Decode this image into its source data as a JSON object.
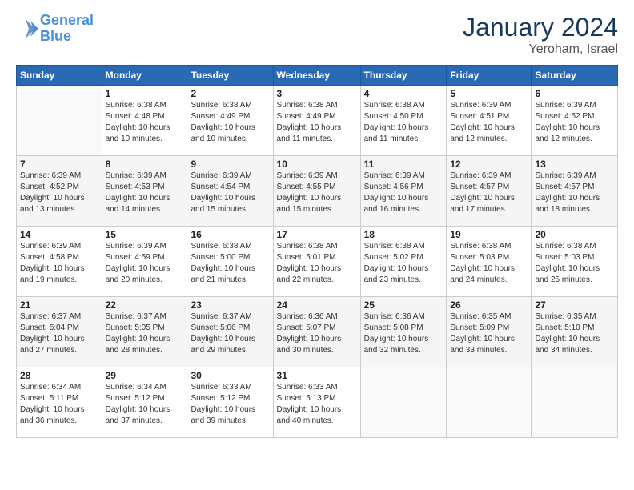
{
  "header": {
    "logo_line1": "General",
    "logo_line2": "Blue",
    "month": "January 2024",
    "location": "Yeroham, Israel"
  },
  "days_of_week": [
    "Sunday",
    "Monday",
    "Tuesday",
    "Wednesday",
    "Thursday",
    "Friday",
    "Saturday"
  ],
  "weeks": [
    [
      {
        "day": "",
        "info": ""
      },
      {
        "day": "1",
        "info": "Sunrise: 6:38 AM\nSunset: 4:48 PM\nDaylight: 10 hours\nand 10 minutes."
      },
      {
        "day": "2",
        "info": "Sunrise: 6:38 AM\nSunset: 4:49 PM\nDaylight: 10 hours\nand 10 minutes."
      },
      {
        "day": "3",
        "info": "Sunrise: 6:38 AM\nSunset: 4:49 PM\nDaylight: 10 hours\nand 11 minutes."
      },
      {
        "day": "4",
        "info": "Sunrise: 6:38 AM\nSunset: 4:50 PM\nDaylight: 10 hours\nand 11 minutes."
      },
      {
        "day": "5",
        "info": "Sunrise: 6:39 AM\nSunset: 4:51 PM\nDaylight: 10 hours\nand 12 minutes."
      },
      {
        "day": "6",
        "info": "Sunrise: 6:39 AM\nSunset: 4:52 PM\nDaylight: 10 hours\nand 12 minutes."
      }
    ],
    [
      {
        "day": "7",
        "info": "Sunrise: 6:39 AM\nSunset: 4:52 PM\nDaylight: 10 hours\nand 13 minutes."
      },
      {
        "day": "8",
        "info": "Sunrise: 6:39 AM\nSunset: 4:53 PM\nDaylight: 10 hours\nand 14 minutes."
      },
      {
        "day": "9",
        "info": "Sunrise: 6:39 AM\nSunset: 4:54 PM\nDaylight: 10 hours\nand 15 minutes."
      },
      {
        "day": "10",
        "info": "Sunrise: 6:39 AM\nSunset: 4:55 PM\nDaylight: 10 hours\nand 15 minutes."
      },
      {
        "day": "11",
        "info": "Sunrise: 6:39 AM\nSunset: 4:56 PM\nDaylight: 10 hours\nand 16 minutes."
      },
      {
        "day": "12",
        "info": "Sunrise: 6:39 AM\nSunset: 4:57 PM\nDaylight: 10 hours\nand 17 minutes."
      },
      {
        "day": "13",
        "info": "Sunrise: 6:39 AM\nSunset: 4:57 PM\nDaylight: 10 hours\nand 18 minutes."
      }
    ],
    [
      {
        "day": "14",
        "info": "Sunrise: 6:39 AM\nSunset: 4:58 PM\nDaylight: 10 hours\nand 19 minutes."
      },
      {
        "day": "15",
        "info": "Sunrise: 6:39 AM\nSunset: 4:59 PM\nDaylight: 10 hours\nand 20 minutes."
      },
      {
        "day": "16",
        "info": "Sunrise: 6:38 AM\nSunset: 5:00 PM\nDaylight: 10 hours\nand 21 minutes."
      },
      {
        "day": "17",
        "info": "Sunrise: 6:38 AM\nSunset: 5:01 PM\nDaylight: 10 hours\nand 22 minutes."
      },
      {
        "day": "18",
        "info": "Sunrise: 6:38 AM\nSunset: 5:02 PM\nDaylight: 10 hours\nand 23 minutes."
      },
      {
        "day": "19",
        "info": "Sunrise: 6:38 AM\nSunset: 5:03 PM\nDaylight: 10 hours\nand 24 minutes."
      },
      {
        "day": "20",
        "info": "Sunrise: 6:38 AM\nSunset: 5:03 PM\nDaylight: 10 hours\nand 25 minutes."
      }
    ],
    [
      {
        "day": "21",
        "info": "Sunrise: 6:37 AM\nSunset: 5:04 PM\nDaylight: 10 hours\nand 27 minutes."
      },
      {
        "day": "22",
        "info": "Sunrise: 6:37 AM\nSunset: 5:05 PM\nDaylight: 10 hours\nand 28 minutes."
      },
      {
        "day": "23",
        "info": "Sunrise: 6:37 AM\nSunset: 5:06 PM\nDaylight: 10 hours\nand 29 minutes."
      },
      {
        "day": "24",
        "info": "Sunrise: 6:36 AM\nSunset: 5:07 PM\nDaylight: 10 hours\nand 30 minutes."
      },
      {
        "day": "25",
        "info": "Sunrise: 6:36 AM\nSunset: 5:08 PM\nDaylight: 10 hours\nand 32 minutes."
      },
      {
        "day": "26",
        "info": "Sunrise: 6:35 AM\nSunset: 5:09 PM\nDaylight: 10 hours\nand 33 minutes."
      },
      {
        "day": "27",
        "info": "Sunrise: 6:35 AM\nSunset: 5:10 PM\nDaylight: 10 hours\nand 34 minutes."
      }
    ],
    [
      {
        "day": "28",
        "info": "Sunrise: 6:34 AM\nSunset: 5:11 PM\nDaylight: 10 hours\nand 36 minutes."
      },
      {
        "day": "29",
        "info": "Sunrise: 6:34 AM\nSunset: 5:12 PM\nDaylight: 10 hours\nand 37 minutes."
      },
      {
        "day": "30",
        "info": "Sunrise: 6:33 AM\nSunset: 5:12 PM\nDaylight: 10 hours\nand 39 minutes."
      },
      {
        "day": "31",
        "info": "Sunrise: 6:33 AM\nSunset: 5:13 PM\nDaylight: 10 hours\nand 40 minutes."
      },
      {
        "day": "",
        "info": ""
      },
      {
        "day": "",
        "info": ""
      },
      {
        "day": "",
        "info": ""
      }
    ]
  ]
}
